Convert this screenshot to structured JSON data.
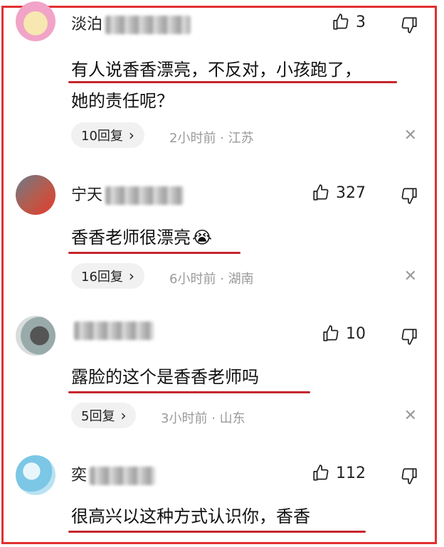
{
  "comments": [
    {
      "username": "淡泊",
      "likes": "3",
      "text_lines": [
        "有人说香香漂亮，不反对，小孩跑了，",
        "她的责任呢？"
      ],
      "replies": "10回复",
      "time": "2小时前",
      "location": "江苏"
    },
    {
      "username": "宁天",
      "likes": "327",
      "text_lines": [
        "香香老师很漂亮"
      ],
      "emoji": "😭",
      "replies": "16回复",
      "time": "6小时前",
      "location": "湖南"
    },
    {
      "username": "",
      "likes": "10",
      "text_lines": [
        "露脸的这个是香香老师吗"
      ],
      "replies": "5回复",
      "time": "3小时前",
      "location": "山东"
    },
    {
      "username": "奕",
      "likes": "112",
      "text_lines": [
        "很高兴以这种方式认识你，香香"
      ]
    }
  ],
  "icons": {
    "like": "thumbs-up-outline",
    "dislike": "thumbs-down-outline",
    "close": "close-x",
    "chevron": "chevron-right"
  },
  "colors": {
    "frame": "#e23030",
    "underline": "#c4262c",
    "meta": "#9a9a9a",
    "pill_bg": "#f1f1f1"
  },
  "separator": "·",
  "chevron_glyph": "›",
  "close_glyph": "✕"
}
